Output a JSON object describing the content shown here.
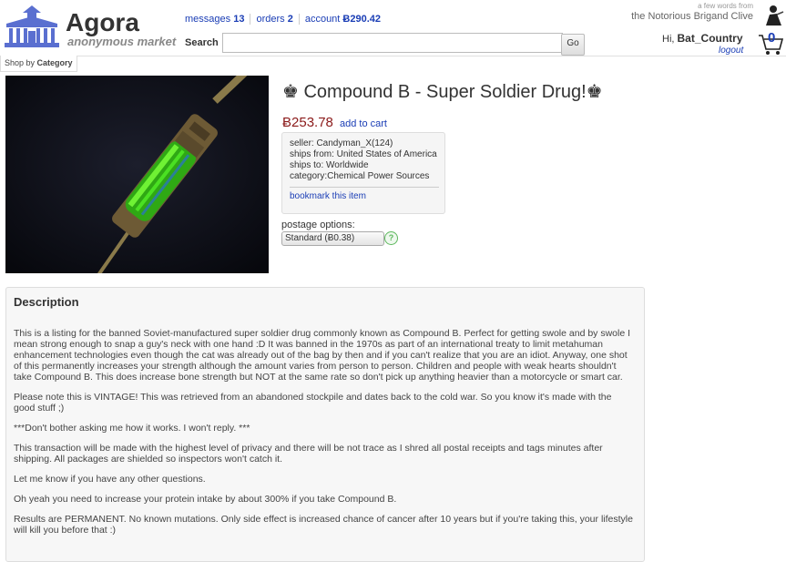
{
  "header": {
    "brand": "Agora",
    "tagline": "anonymous market",
    "links": {
      "messages_label": "messages",
      "messages_count": "13",
      "orders_label": "orders",
      "orders_count": "2",
      "account_label": "account",
      "account_balance": "Ƀ290.42"
    },
    "search": {
      "label": "Search",
      "value": "",
      "button": "Go"
    },
    "quote_intro": "a few words from",
    "quote_author": "the Notorious Brigand Clive",
    "greeting": "Hi,",
    "username": "Bat_Country",
    "logout": "logout",
    "cart_count": "0"
  },
  "category_tab": {
    "prefix": "Shop by",
    "label": "Category"
  },
  "product": {
    "title": "♚ Compound B - Super Soldier Drug!♚",
    "price": "Ƀ253.78",
    "add_to_cart": "add to cart",
    "seller": "seller: Candyman_X(124)",
    "ships_from": "ships from: United States of America",
    "ships_to": "ships to: Worldwide",
    "category": "category:Chemical Power Sources",
    "bookmark": "bookmark this item",
    "postage_label": "postage options:",
    "postage_selected": "Standard (Ƀ0.38)",
    "help_icon": "?"
  },
  "description": {
    "title": "Description",
    "paragraphs": [
      "This is a listing for the banned Soviet-manufactured super soldier drug commonly known as Compound B. Perfect for getting swole and by swole I mean strong enough to snap a guy's neck with one hand :D It was banned in the 1970s as part of an international treaty to limit metahuman enhancement technologies even though the cat was already out of the bag by then and if you can't realize that you are an idiot. Anyway, one shot of this permanently increases your strength although the amount varies from person to person. Children and people with weak hearts shouldn't take Compound B. This does increase bone strength but NOT at the same rate so don't pick up anything heavier than a motorcycle or smart car.",
      "Please note this is VINTAGE! This was retrieved from an abandoned stockpile and dates back to the cold war. So you know it's made with the good stuff ;)",
      "***Don't bother asking me how it works. I won't reply. ***",
      "This transaction will be made with the highest level of privacy and there will be not trace as I shred all postal receipts and tags minutes after shipping. All packages are shielded so inspectors won't catch it.",
      "Let me know if you have any other questions.",
      "Oh yeah you need to increase your protein intake by about 300% if you take Compound B.",
      "Results are PERMANENT. No known mutations. Only side effect is increased chance of cancer after 10 years but if you're taking this, your lifestyle will kill you before that :)"
    ]
  },
  "colors": {
    "link": "#1a3db5",
    "price": "#8b1a1a",
    "logo": "#5a6fd0"
  },
  "icons": [
    "building-logo-icon",
    "avatar-icon",
    "cart-icon",
    "help-icon"
  ]
}
